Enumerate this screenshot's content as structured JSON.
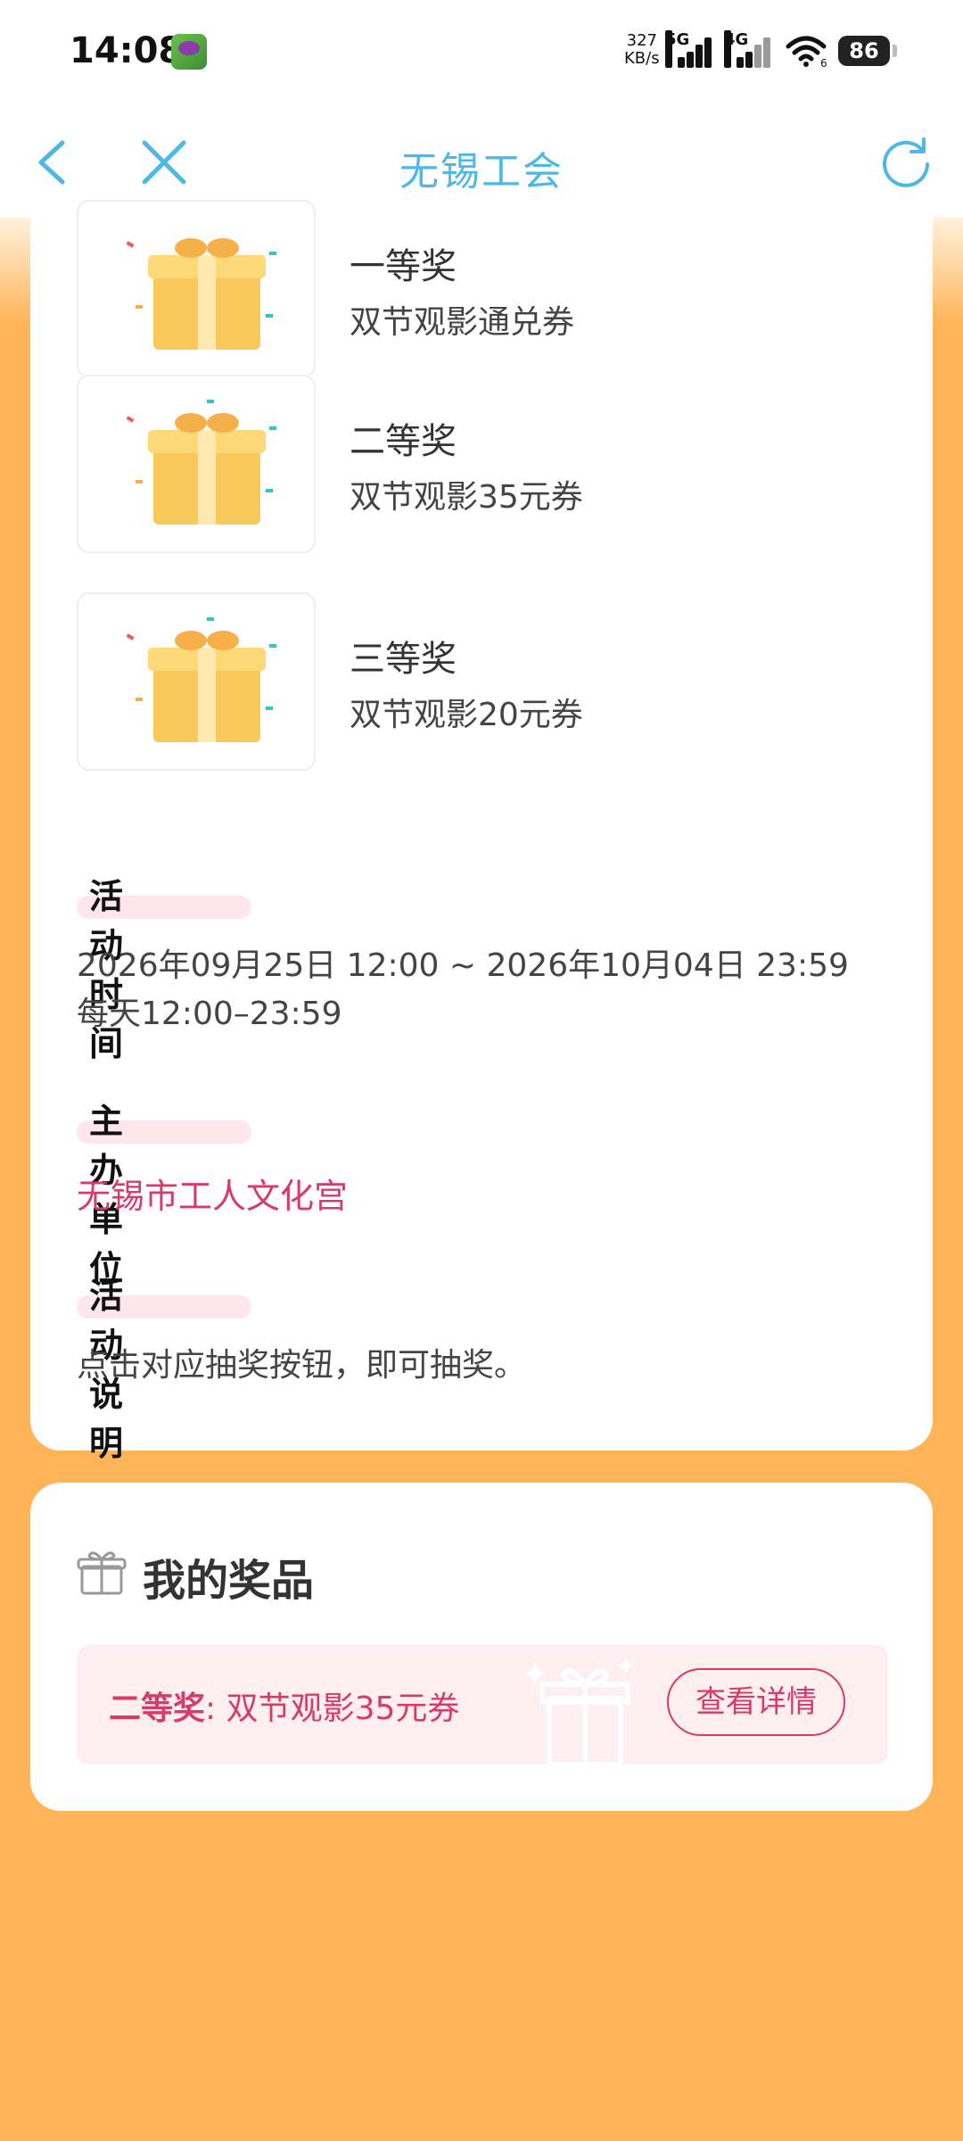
{
  "status_bar": {
    "time": "14:08",
    "net_speed_value": "327",
    "net_speed_unit": "KB/s",
    "signal1_type": "5G",
    "signal2_type": "4G",
    "wifi_sub": "6",
    "battery": "86"
  },
  "nav": {
    "title": "无锡工会",
    "back_icon": "chevron-left-icon",
    "close_icon": "close-icon",
    "refresh_icon": "refresh-icon",
    "accent_color": "#4DB8E3"
  },
  "prizes": [
    {
      "name": "一等奖",
      "desc": "双节观影通兑券"
    },
    {
      "name": "二等奖",
      "desc": "双节观影35元券"
    },
    {
      "name": "三等奖",
      "desc": "双节观影20元券"
    }
  ],
  "sections": {
    "time": {
      "label": "活动时间",
      "line1": "2026年09月25日 12:00 ~ 2026年10月04日 23:59",
      "line2": "每天12:00–23:59"
    },
    "organizer": {
      "label": "主办单位",
      "value": "无锡市工人文化宫"
    },
    "description": {
      "label": "活动说明",
      "value": "点击对应抽奖按钮，即可抽奖。"
    }
  },
  "my_prizes": {
    "title": "我的奖品",
    "icon": "gift-icon",
    "item_level": "二等奖",
    "item_sep": ": ",
    "item_desc": "双节观影35元券",
    "detail_button": "查看详情"
  },
  "colors": {
    "background": "#FFB457",
    "pink": "#D73B6B",
    "card": "#FFFFFF"
  }
}
